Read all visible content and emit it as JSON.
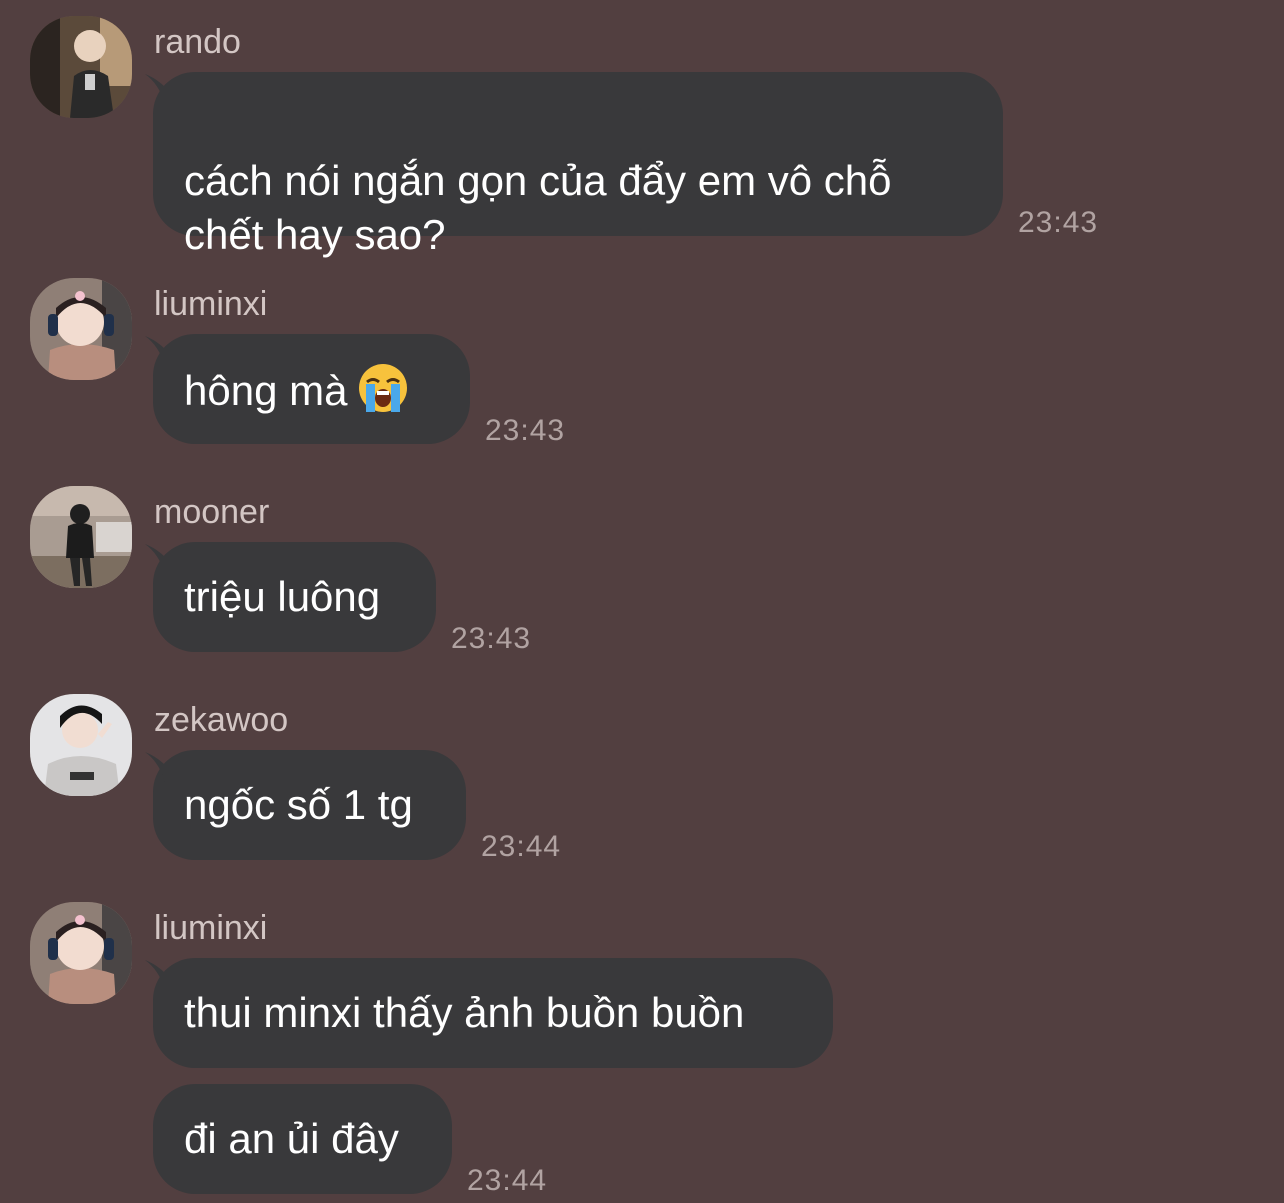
{
  "colors": {
    "background": "#523f40",
    "bubble": "#39393b",
    "text": "#ffffff",
    "sender": "#d3c6c4",
    "timestamp": "#b1a3a2"
  },
  "messages": [
    {
      "sender": "rando",
      "avatar": "user-photo-avatar",
      "bubbles": [
        "cách nói ngắn gọn của đẩy em vô chỗ\nchết hay sao?"
      ],
      "time": "23:43"
    },
    {
      "sender": "liuminxi",
      "avatar": "user-photo-avatar",
      "bubbles": [
        "hông mà"
      ],
      "emoji": "loudly-crying-face-icon",
      "time": "23:43"
    },
    {
      "sender": "mooner",
      "avatar": "user-photo-avatar",
      "bubbles": [
        "triệu luông"
      ],
      "time": "23:43"
    },
    {
      "sender": "zekawoo",
      "avatar": "user-photo-avatar",
      "bubbles": [
        "ngốc số 1 tg"
      ],
      "time": "23:44"
    },
    {
      "sender": "liuminxi",
      "avatar": "user-photo-avatar",
      "bubbles": [
        "thui minxi thấy ảnh buồn buồn",
        "đi an ủi đây"
      ],
      "time": "23:44"
    }
  ]
}
